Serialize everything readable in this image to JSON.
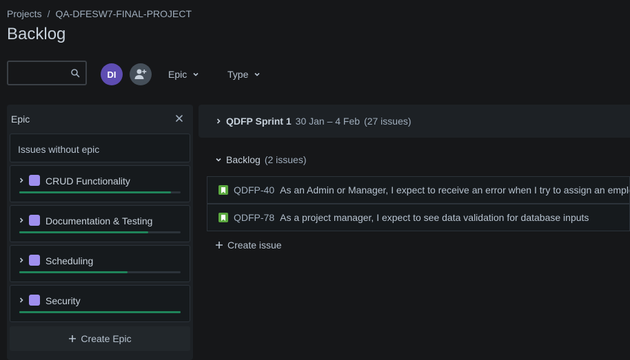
{
  "breadcrumb": {
    "projects": "Projects",
    "separator": "/",
    "project": "QA-DFESW7-FINAL-PROJECT"
  },
  "page": {
    "title": "Backlog"
  },
  "toolbar": {
    "search_value": "",
    "avatar_initials": "DI",
    "filters": [
      {
        "label": "Epic"
      },
      {
        "label": "Type"
      }
    ]
  },
  "epic_panel": {
    "title": "Epic",
    "issues_without_epic": "Issues without epic",
    "epics": [
      {
        "name": "CRUD Functionality",
        "progress": 0.94
      },
      {
        "name": "Documentation & Testing",
        "progress": 0.8
      },
      {
        "name": "Scheduling",
        "progress": 0.67
      },
      {
        "name": "Security",
        "progress": 1.0
      }
    ],
    "create_label": "Create Epic"
  },
  "sprint": {
    "name": "QDFP Sprint 1",
    "dates": "30 Jan – 4 Feb",
    "count": "(27 issues)"
  },
  "backlog": {
    "title": "Backlog",
    "count": "(2 issues)",
    "issues": [
      {
        "key": "QDFP-40",
        "summary": "As an Admin or Manager, I expect to receive an error when I try to assign an emplo"
      },
      {
        "key": "QDFP-78",
        "summary": "As a project manager, I expect to see data validation for database inputs"
      }
    ],
    "create_label": "Create issue"
  },
  "colors": {
    "accent_purple": "#5e4db2",
    "epic_color": "#9f8fef",
    "progress_green": "#1f845a",
    "story_green": "#5aa83e"
  }
}
